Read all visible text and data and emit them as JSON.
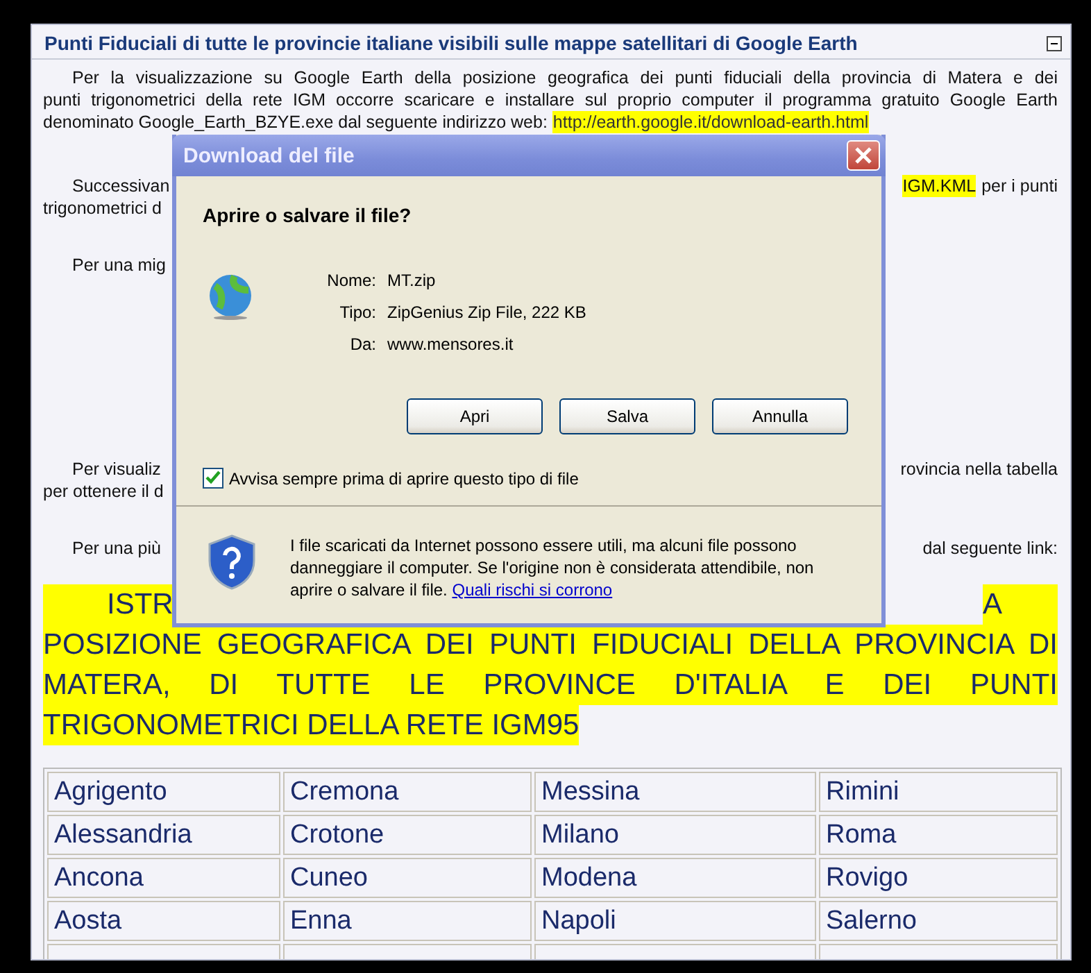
{
  "panel": {
    "title": "Punti Fiduciali di tutte le provincie italiane visibili sulle mappe satellitari di Google Earth",
    "collapsed": false
  },
  "paragraphs": [
    {
      "lines": [
        {
          "left": "Per la visualizzazione su Google Earth della posizione geografica dei punti fiduciali della provincia di Matera e dei"
        },
        {
          "left": "punti trigonometrici della rete IGM occorre scaricare e installare sul proprio computer il programma gratuito Google Earth"
        },
        {
          "left": "denominato Google_Earth_BZYE.exe dal seguente indirizzo web:",
          "link": "http://earth.google.it/download-earth.html"
        }
      ]
    },
    {
      "lines": [
        {
          "left": "Successivan",
          "right_mark": "IGM.KML",
          "right": "per i punti"
        },
        {
          "left": "trigonometrici d"
        }
      ]
    },
    {
      "lines": [
        {
          "left": "Per una mig"
        }
      ]
    },
    {
      "lines": [
        {
          "left": "Per visualiz",
          "right": "rovincia nella tabella"
        },
        {
          "left": "per ottenere il d"
        }
      ]
    },
    {
      "lines": [
        {
          "left": "Per una più",
          "right": "dal seguente link:"
        }
      ]
    }
  ],
  "banner": {
    "first_left": "ISTR",
    "first_right": "A",
    "lines": [
      "POSIZIONE GEOGRAFICA DEI PUNTI FIDUCIALI DELLA PROVINCIA DI",
      "MATERA, DI TUTTE LE PROVINCE D'ITALIA E DEI PUNTI",
      "TRIGONOMETRICI DELLA RETE IGM95"
    ]
  },
  "provinces": [
    [
      "Agrigento",
      "Cremona",
      "Messina",
      "Rimini"
    ],
    [
      "Alessandria",
      "Crotone",
      "Milano",
      "Roma"
    ],
    [
      "Ancona",
      "Cuneo",
      "Modena",
      "Rovigo"
    ],
    [
      "Aosta",
      "Enna",
      "Napoli",
      "Salerno"
    ]
  ],
  "dialog": {
    "title": "Download del file",
    "question": "Aprire o salvare il file?",
    "fields": [
      {
        "label": "Nome:",
        "value": "MT.zip"
      },
      {
        "label": "Tipo:",
        "value": "ZipGenius Zip File, 222 KB"
      },
      {
        "label": "Da:",
        "value": "www.mensores.it"
      }
    ],
    "buttons": [
      "Apri",
      "Salva",
      "Annulla"
    ],
    "checkbox": {
      "label": "Avvisa sempre prima di aprire questo tipo di file",
      "checked": true
    },
    "warning": "I file scaricati da Internet possono essere utili, ma alcuni file possono danneggiare il computer. Se l'origine non è considerata attendibile, non aprire o salvare il file.",
    "warning_link": "Quali rischi si corrono"
  }
}
